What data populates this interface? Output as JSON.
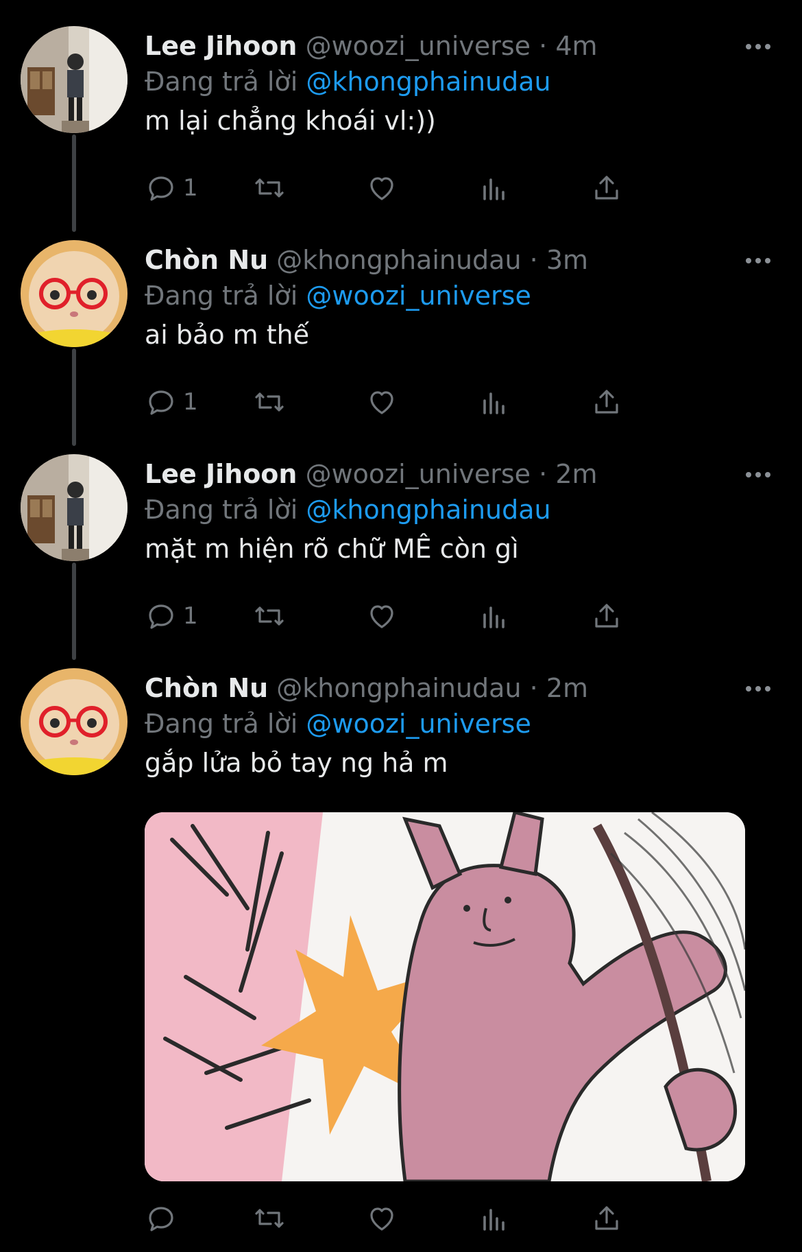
{
  "tweets": [
    {
      "name": "Lee Jihoon",
      "handle": "@woozi_universe",
      "dot": "·",
      "time": "4m",
      "replying_prefix": "Đang trả lời",
      "replying_to": "@khongphainudau",
      "text": "m lại chẳng khoái vl:))",
      "reply_count": "1",
      "avatar_icon": "person-photo-avatar"
    },
    {
      "name": "Chòn Nu",
      "handle": "@khongphainudau",
      "dot": "·",
      "time": "3m",
      "replying_prefix": "Đang trả lời",
      "replying_to": "@woozi_universe",
      "text": "ai bảo m thế",
      "reply_count": "1",
      "avatar_icon": "cat-with-red-glasses-avatar"
    },
    {
      "name": "Lee Jihoon",
      "handle": "@woozi_universe",
      "dot": "·",
      "time": "2m",
      "replying_prefix": "Đang trả lời",
      "replying_to": "@khongphainudau",
      "text": "mặt m hiện rõ chữ MÊ còn gì",
      "reply_count": "1",
      "avatar_icon": "person-photo-avatar"
    },
    {
      "name": "Chòn Nu",
      "handle": "@khongphainudau",
      "dot": "·",
      "time": "2m",
      "replying_prefix": "Đang trả lời",
      "replying_to": "@woozi_universe",
      "text": "gắp lửa bỏ tay ng hả m",
      "reply_count": "",
      "avatar_icon": "cat-with-red-glasses-avatar",
      "media": "pink-rabbit-swinging-meme-image"
    }
  ],
  "colors": {
    "background": "#000000",
    "text": "#e7e9ea",
    "secondary": "#71767b",
    "mention": "#1d9bf0",
    "thread_line": "#3e4144"
  },
  "icons": [
    "reply-icon",
    "retweet-icon",
    "like-icon",
    "views-icon",
    "share-icon",
    "more-icon"
  ]
}
